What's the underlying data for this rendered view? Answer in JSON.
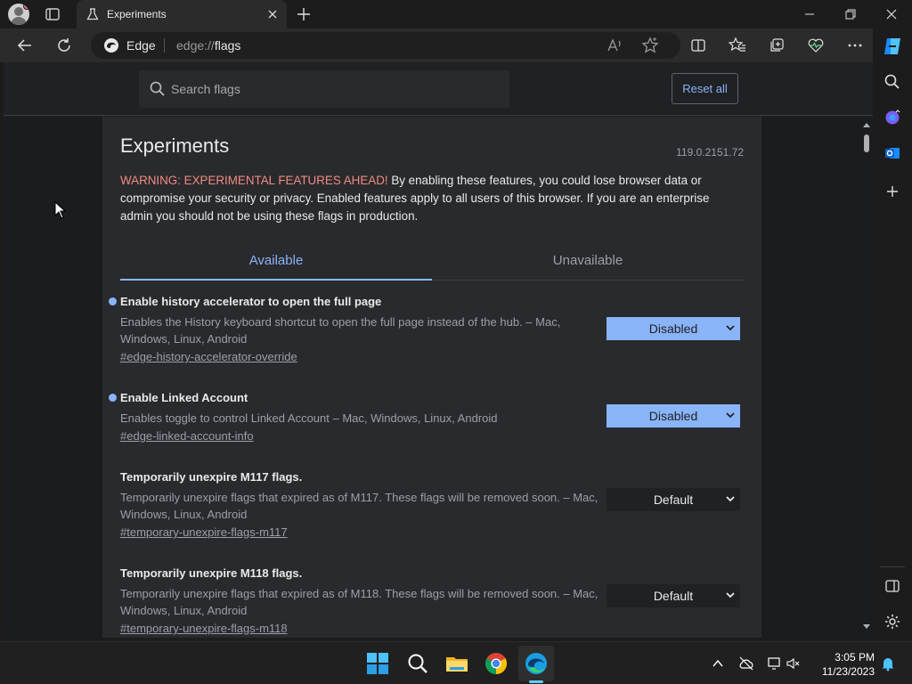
{
  "window": {
    "tab_title": "Experiments"
  },
  "addressbar": {
    "site_label": "Edge",
    "url_prefix": "edge://",
    "url_path": "flags"
  },
  "flags_page": {
    "search_placeholder": "Search flags",
    "reset_label": "Reset all",
    "title": "Experiments",
    "version": "119.0.2151.72",
    "warning_label": "WARNING: EXPERIMENTAL FEATURES AHEAD!",
    "warning_text": " By enabling these features, you could lose browser data or compromise your security or privacy. Enabled features apply to all users of this browser. If you are an enterprise admin you should not be using these flags in production.",
    "tabs": [
      {
        "label": "Available",
        "active": true
      },
      {
        "label": "Unavailable",
        "active": false
      }
    ],
    "flags": [
      {
        "name": "Enable history accelerator to open the full page",
        "description": "Enables the History keyboard shortcut to open the full page instead of the hub. – Mac, Windows, Linux, Android",
        "link": "#edge-history-accelerator-override",
        "value": "Disabled",
        "modified": true
      },
      {
        "name": "Enable Linked Account",
        "description": "Enables toggle to control Linked Account – Mac, Windows, Linux, Android",
        "link": "#edge-linked-account-info",
        "value": "Disabled",
        "modified": true
      },
      {
        "name": "Temporarily unexpire M117 flags.",
        "description": "Temporarily unexpire flags that expired as of M117. These flags will be removed soon. – Mac, Windows, Linux, Android",
        "link": "#temporary-unexpire-flags-m117",
        "value": "Default",
        "modified": false
      },
      {
        "name": "Temporarily unexpire M118 flags.",
        "description": "Temporarily unexpire flags that expired as of M118. These flags will be removed soon. – Mac, Windows, Linux, Android",
        "link": "#temporary-unexpire-flags-m118",
        "value": "Default",
        "modified": false
      }
    ]
  },
  "taskbar": {
    "time": "3:05 PM",
    "date": "11/23/2023"
  },
  "colors": {
    "accent": "#8ab4f8",
    "warning": "#f28b82",
    "taskbar_indicator": "#60cdff"
  }
}
